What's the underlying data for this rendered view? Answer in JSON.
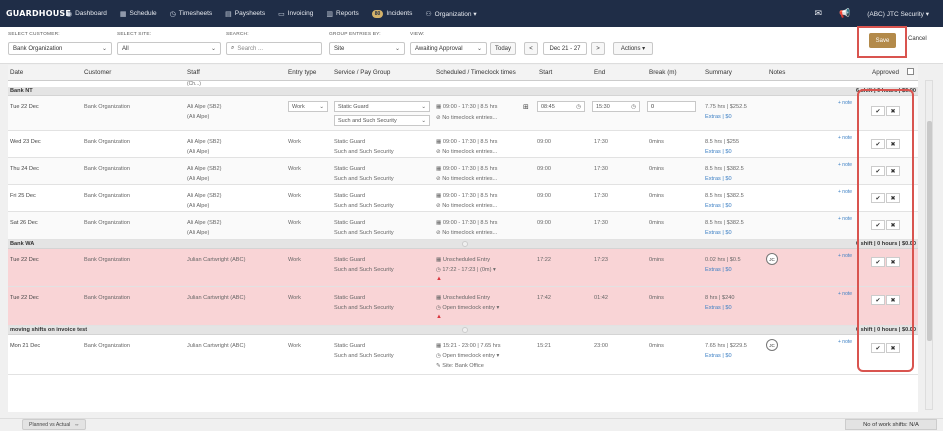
{
  "nav": {
    "logo": "GUARDHOUSE",
    "items": [
      {
        "label": "Dashboard",
        "icon": "dashboard-icon",
        "glyph": "◉"
      },
      {
        "label": "Schedule",
        "icon": "calendar-icon",
        "glyph": "▦"
      },
      {
        "label": "Timesheets",
        "icon": "clock-icon",
        "glyph": "◷"
      },
      {
        "label": "Paysheets",
        "icon": "document-icon",
        "glyph": "▤"
      },
      {
        "label": "Invoicing",
        "icon": "invoice-icon",
        "glyph": "▭"
      },
      {
        "label": "Reports",
        "icon": "chart-icon",
        "glyph": "▥"
      },
      {
        "label": "Incidents",
        "icon": "alert-icon",
        "glyph": "",
        "badge": "80"
      },
      {
        "label": "Organization ▾",
        "icon": "org-icon",
        "glyph": "⚇"
      }
    ],
    "account": "(ABC) JTC Security ▾"
  },
  "filters": {
    "customer_label": "SELECT CUSTOMER:",
    "customer_value": "Bank Organization",
    "site_label": "SELECT SITE:",
    "site_value": "All",
    "search_label": "SEARCH:",
    "search_placeholder": "Search ...",
    "group_label": "GROUP ENTRIES BY:",
    "group_value": "Site",
    "view_label": "VIEW:",
    "view_value": "Awaiting Approval",
    "today": "Today",
    "prev": "<",
    "range": "Dec 21 - 27",
    "next": ">",
    "actions": "Actions ▾",
    "save": "Save",
    "cancel": "Cancel"
  },
  "columns": [
    "Date",
    "Customer",
    "Staff",
    "Entry type",
    "Service / Pay Group",
    "Scheduled / Timeclock times",
    "Start",
    "End",
    "Break (m)",
    "Summary",
    "Notes",
    "Approved"
  ],
  "prev_row_stub": "(Ch...)",
  "groups": [
    {
      "name": "Bank NT",
      "summary": "6 shift | 0 hours | $0.00"
    },
    {
      "name": "Bank WA",
      "summary": "0 shift | 0 hours | $0.00"
    },
    {
      "name": "moving shifts on invoice test",
      "summary": "0 shift | 0 hours | $0.00"
    }
  ],
  "rows": [
    {
      "date": "Tue 22 Dec",
      "customer": "Bank Organization",
      "staff": "Ali Alpe (SB2)",
      "staff2": "(Ali Alpe)",
      "entry": "Work",
      "service": "Static Guard",
      "pay": "Such and Such Security",
      "sched": "▦ 09:00 - 17:30 | 8.5 hrs",
      "clock": "⊘ No timeclock entries...",
      "start": "08:45",
      "end": "15:30",
      "break": "0",
      "summary": "7.75 hrs | $252.5",
      "extras": "Extras | $0",
      "note": "+ note"
    },
    {
      "date": "Wed 23 Dec",
      "customer": "Bank Organization",
      "staff": "Ali Alpe (SB2)",
      "staff2": "(Ali Alpe)",
      "entry": "Work",
      "service": "Static Guard",
      "pay": "Such and Such Security",
      "sched": "▦ 09:00 - 17:30 | 8.5 hrs",
      "clock": "⊘ No timeclock entries...",
      "start": "09:00",
      "end": "17:30",
      "break": "0mins",
      "summary": "8.5 hrs | $255",
      "extras": "Extras | $0",
      "note": "+ note"
    },
    {
      "date": "Thu 24 Dec",
      "customer": "Bank Organization",
      "staff": "Ali Alpe (SB2)",
      "staff2": "(Ali Alpe)",
      "entry": "Work",
      "service": "Static Guard",
      "pay": "Such and Such Security",
      "sched": "▦ 09:00 - 17:30 | 8.5 hrs",
      "clock": "⊘ No timeclock entries...",
      "start": "09:00",
      "end": "17:30",
      "break": "0mins",
      "summary": "8.5 hrs | $382.5",
      "extras": "Extras | $0",
      "note": "+ note"
    },
    {
      "date": "Fri 25 Dec",
      "customer": "Bank Organization",
      "staff": "Ali Alpe (SB2)",
      "staff2": "(Ali Alpe)",
      "entry": "Work",
      "service": "Static Guard",
      "pay": "Such and Such Security",
      "sched": "▦ 09:00 - 17:30 | 8.5 hrs",
      "clock": "⊘ No timeclock entries...",
      "start": "09:00",
      "end": "17:30",
      "break": "0mins",
      "summary": "8.5 hrs | $382.5",
      "extras": "Extras | $0",
      "note": "+ note"
    },
    {
      "date": "Sat 26 Dec",
      "customer": "Bank Organization",
      "staff": "Ali Alpe (SB2)",
      "staff2": "(Ali Alpe)",
      "entry": "Work",
      "service": "Static Guard",
      "pay": "Such and Such Security",
      "sched": "▦ 09:00 - 17:30 | 8.5 hrs",
      "clock": "⊘ No timeclock entries...",
      "start": "09:00",
      "end": "17:30",
      "break": "0mins",
      "summary": "8.5 hrs | $382.5",
      "extras": "Extras | $0",
      "note": "+ note"
    },
    {
      "date": "Tue 22 Dec",
      "customer": "Bank Organization",
      "staff": "Julian Cartwright (ABC)",
      "entry": "Work",
      "service": "Static Guard",
      "pay": "Such and Such Security",
      "sched": "▦ Unscheduled Entry",
      "clock": "◷ 17:22 - 17:23 | (0m) ▾",
      "start": "17:22",
      "end": "17:23",
      "break": "0mins",
      "summary": "0.02 hrs | $0.5",
      "extras": "Extras | $0",
      "note": "+ note",
      "avatar": "JC"
    },
    {
      "date": "Tue 22 Dec",
      "customer": "Bank Organization",
      "staff": "Julian Cartwright (ABC)",
      "entry": "Work",
      "service": "Static Guard",
      "pay": "Such and Such Security",
      "sched": "▦ Unscheduled Entry",
      "clock": "◷ Open timeclock entry ▾",
      "start": "17:42",
      "end": "01:42",
      "break": "0mins",
      "summary": "8 hrs | $240",
      "extras": "Extras | $0",
      "note": "+ note"
    },
    {
      "date": "Mon 21 Dec",
      "customer": "Bank Organization",
      "staff": "Julian Cartwright (ABC)",
      "entry": "Work",
      "service": "Static Guard",
      "pay": "Such and Such Security",
      "sched": "▦ 15:21 - 23:00 | 7.65 hrs",
      "clock": "◷ Open timeclock entry ▾",
      "site": "✎ Site: Bank Office",
      "start": "15:21",
      "end": "23:00",
      "break": "0mins",
      "summary": "7.65 hrs | $229.5",
      "extras": "Extras | $0",
      "note": "+ note",
      "avatar": "JC"
    }
  ],
  "approve_glyph": "✔",
  "reject_glyph": "✖",
  "footer": {
    "planned_vs_actual": "Planned vs Actual",
    "planned_vs_actual_icon": "⇔",
    "work_shifts": "No of work shifts: N/A"
  }
}
